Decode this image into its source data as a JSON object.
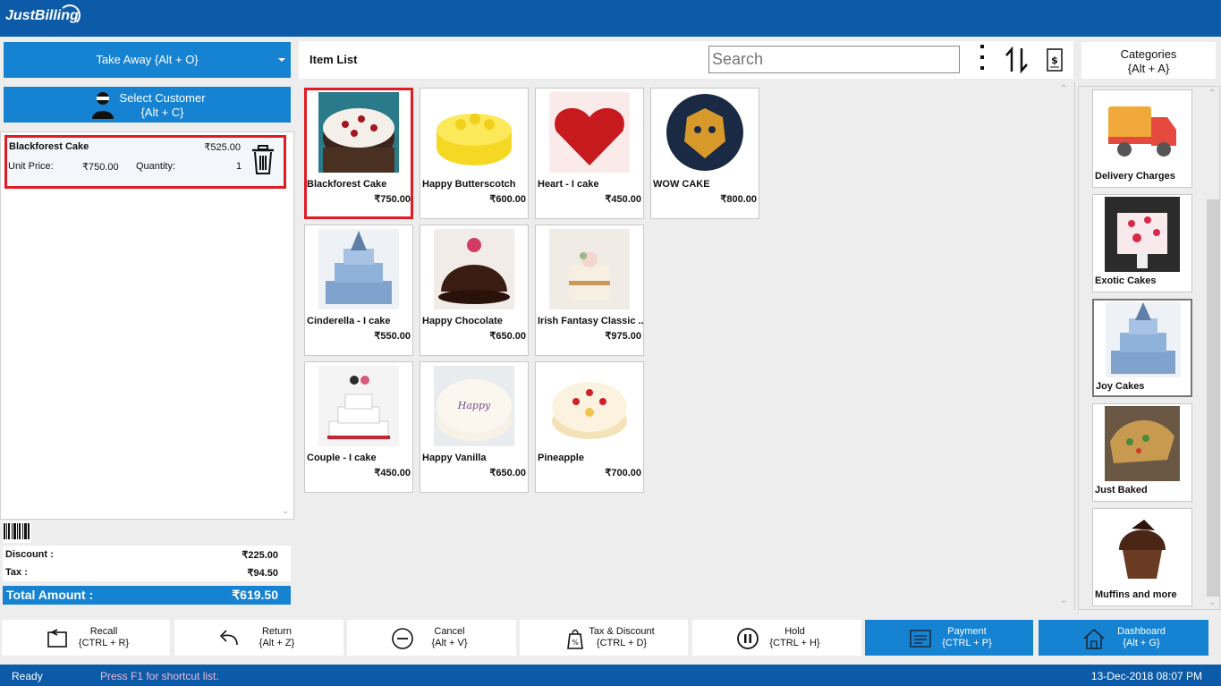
{
  "app": {
    "logo": "JustBilling"
  },
  "left": {
    "order_type": "Take Away {Alt + O}",
    "customer_line1": "Select Customer",
    "customer_line2": "{Alt + C}",
    "cart": [
      {
        "name": "Blackforest Cake",
        "line_total": "₹525.00",
        "unit_price_label": "Unit Price:",
        "unit_price": "₹750.00",
        "quantity_label": "Quantity:",
        "quantity": "1"
      }
    ],
    "totals": {
      "discount_label": "Discount :",
      "discount": "₹225.00",
      "tax_label": "Tax :",
      "tax": "₹94.50",
      "total_label": "Total Amount :",
      "total": "₹619.50"
    }
  },
  "center": {
    "title": "Item List",
    "search_placeholder": "Search",
    "items": [
      {
        "name": "Blackforest Cake",
        "price": "₹750.00",
        "icon": "blackforest-cake"
      },
      {
        "name": "Happy Butterscotch",
        "price": "₹600.00",
        "icon": "butterscotch-cake"
      },
      {
        "name": "Heart - I cake",
        "price": "₹450.00",
        "icon": "heart-cake"
      },
      {
        "name": "WOW CAKE",
        "price": "₹800.00",
        "icon": "lion-cake"
      },
      {
        "name": "Cinderella - I cake",
        "price": "₹550.00",
        "icon": "cinderella-cake"
      },
      {
        "name": "Happy Chocolate",
        "price": "₹650.00",
        "icon": "chocolate-cake"
      },
      {
        "name": "Irish Fantasy Classic ...",
        "price": "₹975.00",
        "icon": "irish-cake"
      },
      {
        "name": "Couple - I cake",
        "price": "₹450.00",
        "icon": "couple-cake"
      },
      {
        "name": "Happy Vanilla",
        "price": "₹650.00",
        "icon": "vanilla-cake"
      },
      {
        "name": "Pineapple",
        "price": "₹700.00",
        "icon": "pineapple-cake"
      }
    ]
  },
  "categories": {
    "title_line1": "Categories",
    "title_line2": "{Alt + A}",
    "items": [
      {
        "name": "Delivery Charges",
        "icon": "truck"
      },
      {
        "name": "Exotic Cakes",
        "icon": "exotic-cake"
      },
      {
        "name": "Joy Cakes",
        "icon": "joy-cake"
      },
      {
        "name": "Just Baked",
        "icon": "baked"
      },
      {
        "name": "Muffins and more",
        "icon": "muffin"
      }
    ]
  },
  "actions": [
    {
      "label": "Recall",
      "shortcut": "{CTRL + R}",
      "icon": "recall-icon"
    },
    {
      "label": "Return",
      "shortcut": "{Alt + Z}",
      "icon": "return-icon"
    },
    {
      "label": "Cancel",
      "shortcut": "{Alt + V}",
      "icon": "cancel-icon"
    },
    {
      "label": "Tax & Discount",
      "shortcut": "{CTRL + D}",
      "icon": "tax-discount-icon"
    },
    {
      "label": "Hold",
      "shortcut": "{CTRL + H}",
      "icon": "hold-icon"
    },
    {
      "label": "Payment",
      "shortcut": "{CTRL + P}",
      "icon": "payment-icon"
    },
    {
      "label": "Dashboard",
      "shortcut": "{Alt + G}",
      "icon": "dashboard-icon"
    }
  ],
  "status": {
    "state": "Ready",
    "hint": "Press F1 for shortcut list.",
    "datetime": "13-Dec-2018 08:07 PM"
  },
  "colors": {
    "brand": "#0b5ba8",
    "accent": "#1682d2",
    "selection": "#e01b24"
  }
}
